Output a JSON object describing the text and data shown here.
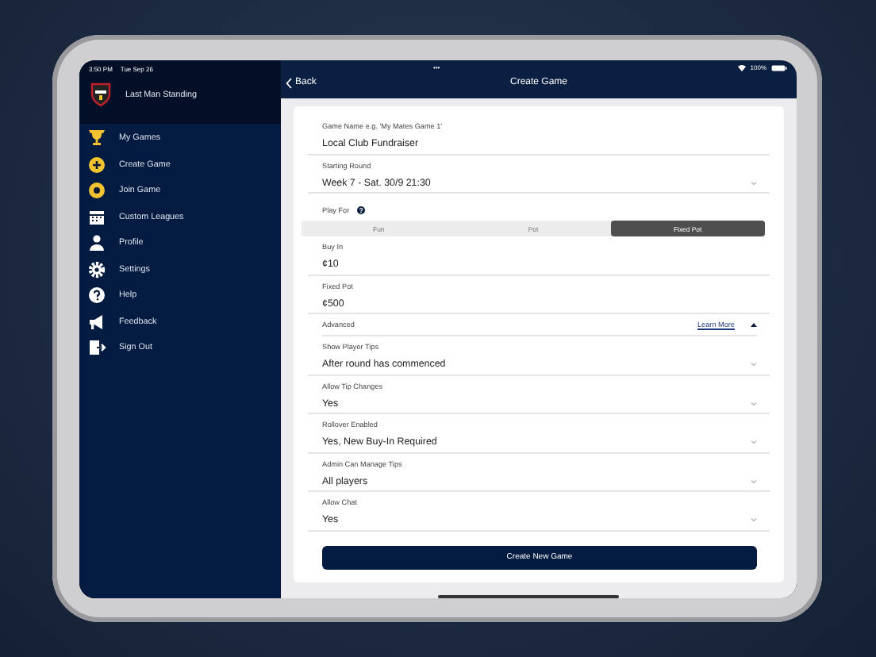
{
  "status_bar": {
    "time": "3:50 PM",
    "date": "Tue Sep 26",
    "dots": "•••",
    "battery": "100%"
  },
  "sidebar": {
    "app_name": "Last Man Standing",
    "items": [
      {
        "label": "My Games"
      },
      {
        "label": "Create Game"
      },
      {
        "label": "Join Game"
      },
      {
        "label": "Custom Leagues"
      },
      {
        "label": "Profile"
      },
      {
        "label": "Settings"
      },
      {
        "label": "Help"
      },
      {
        "label": "Feedback"
      },
      {
        "label": "Sign Out"
      }
    ]
  },
  "nav_bar": {
    "back": "Back",
    "title": "Create Game"
  },
  "form": {
    "fields": [
      {
        "kind": "text",
        "label": "Game Name e.g. 'My Mates Game 1'",
        "value": "Local Club Fundraiser"
      },
      {
        "kind": "select",
        "label": "Starting Round",
        "value": "Week 7 - Sat. 30/9 21:30"
      },
      {
        "kind": "segmented",
        "label": "Play For",
        "options": [
          {
            "label": "Fun",
            "selected": false
          },
          {
            "label": "Pot",
            "selected": false
          },
          {
            "label": "Fixed Pot",
            "selected": true
          }
        ]
      },
      {
        "kind": "text",
        "label": "Buy In",
        "value": "¢10"
      },
      {
        "kind": "text",
        "label": "Fixed Pot",
        "value": "¢500"
      },
      {
        "kind": "expander",
        "label": "Advanced",
        "link": "Learn More",
        "expanded": true
      },
      {
        "kind": "select",
        "label": "Show Player Tips",
        "value": "After round has commenced"
      },
      {
        "kind": "select",
        "label": "Allow Tip Changes",
        "value": "Yes"
      },
      {
        "kind": "select",
        "label": "Rollover Enabled",
        "value": "Yes, New Buy-In Required"
      },
      {
        "kind": "select",
        "label": "Admin Can Manage Tips",
        "value": "All players"
      },
      {
        "kind": "select",
        "label": "Allow Chat",
        "value": "Yes"
      }
    ],
    "submit": "Create New Game"
  }
}
